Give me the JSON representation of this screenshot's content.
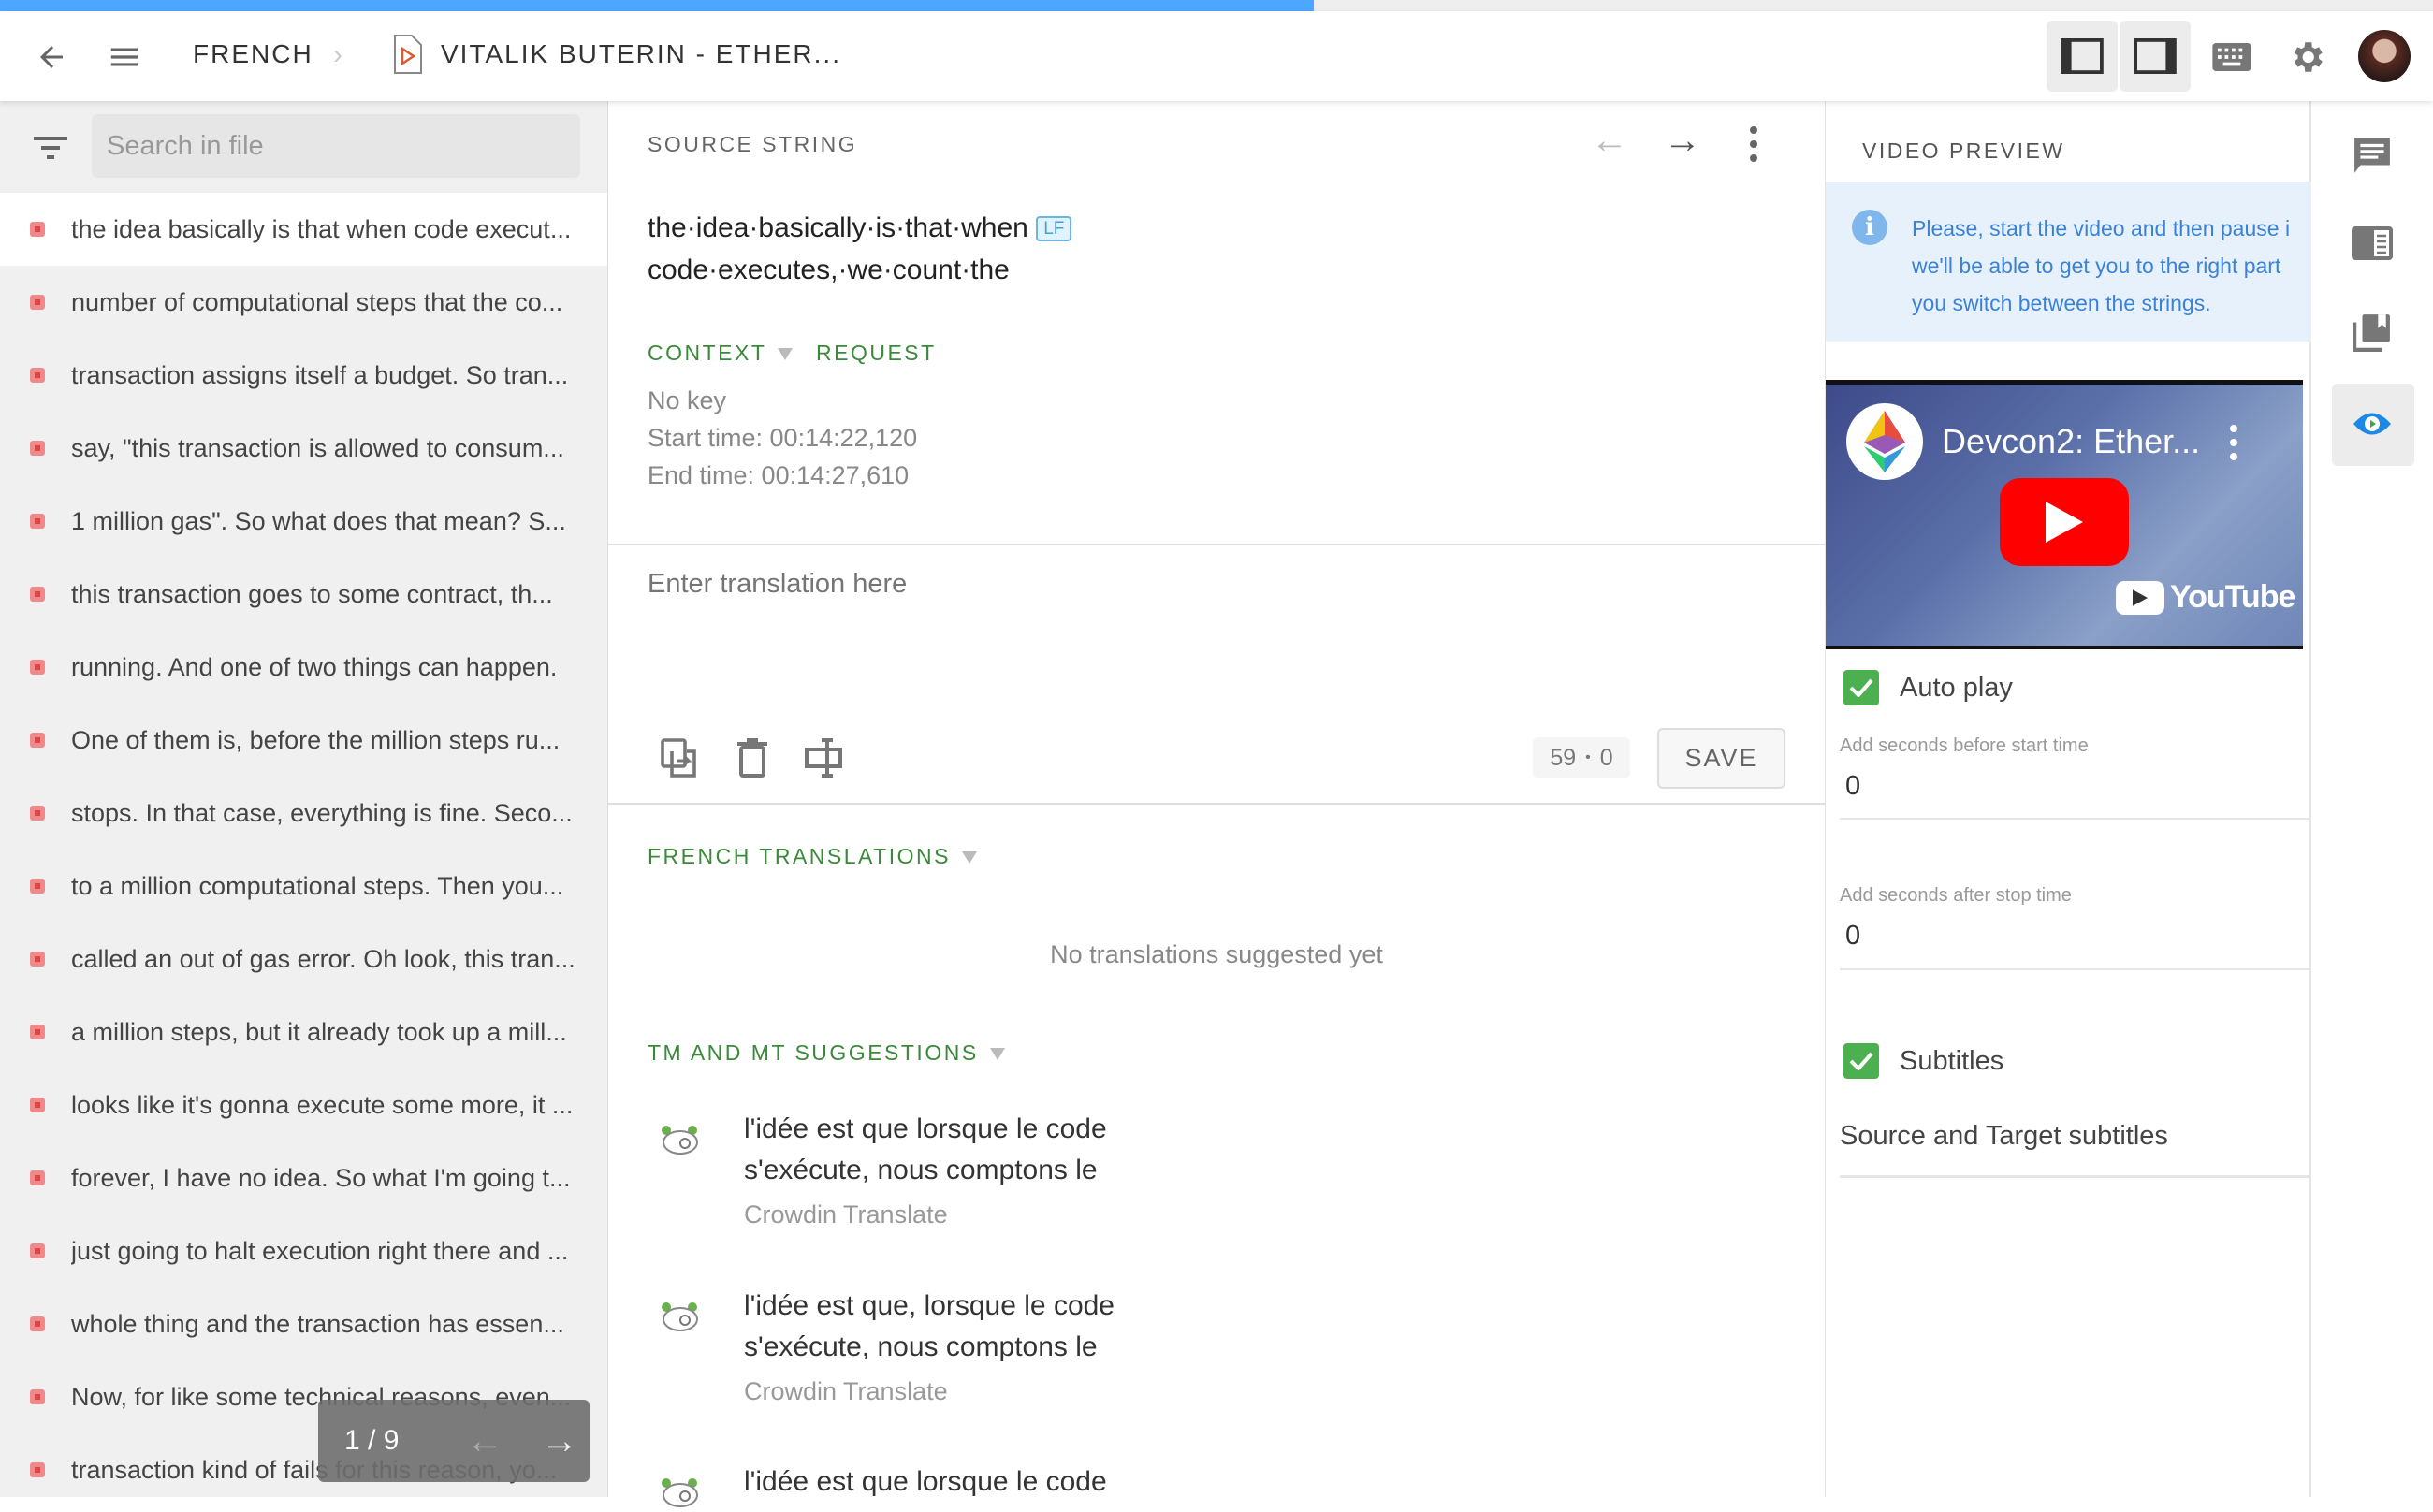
{
  "progress_percent": 54,
  "colors": {
    "accent": "#4da6ff",
    "green": "#3a8a3a",
    "error_dot": "#f08a8a",
    "info_bg": "#e6f1fc",
    "info_text": "#3b82d6"
  },
  "header": {
    "breadcrumb_language": "FRENCH",
    "file_title": "VITALIK BUTERIN - ETHER...",
    "icons": [
      "back-arrow-icon",
      "menu-icon",
      "chevron-right-icon",
      "video-file-icon",
      "layout-left-icon",
      "layout-right-icon",
      "keyboard-icon",
      "gear-icon",
      "avatar"
    ]
  },
  "left": {
    "search_placeholder": "Search in file",
    "items": [
      "the idea basically is that when code execut...",
      "number of computational steps that the co...",
      "transaction assigns itself a budget. So tran...",
      "say, \"this transaction is allowed to consum...",
      "1 million gas\". So what does that mean? S...",
      "this transaction goes to some contract, th...",
      "running. And one of two things can happen.",
      "One of them is, before the million steps ru...",
      "stops. In that case, everything is fine. Seco...",
      "to a million computational steps. Then you...",
      "called an out of gas error. Oh look, this tran...",
      "a million steps, but it already took up a mill...",
      "looks like it's gonna execute some more, it ...",
      "forever, I have no idea. So what I'm going t...",
      "just going to halt execution right there and ...",
      "whole thing and the transaction has essen...",
      "Now, for like some technical reasons, even...",
      "transaction kind of fails for this reason, yo..."
    ],
    "pager": {
      "text": "1 / 9"
    }
  },
  "editor": {
    "source_label": "SOURCE STRING",
    "source_lines": [
      "the·idea·basically·is·that·when",
      "code·executes,·we·count·the"
    ],
    "lf_badge": "LF",
    "context_tab": "CONTEXT",
    "request_tab": "REQUEST",
    "no_key": "No key",
    "start_time": "Start time: 00:14:22,120",
    "end_time": "End time: 00:14:27,610",
    "translation_placeholder": "Enter translation here",
    "counter_source": "59",
    "counter_target": "0",
    "save_label": "SAVE",
    "french_translations_label": "FRENCH TRANSLATIONS",
    "no_translations": "No translations suggested yet",
    "tm_mt_label": "TM AND MT SUGGESTIONS",
    "suggestions": [
      {
        "line1": "l'idée est que lorsque le code",
        "line2": "s'exécute, nous comptons le",
        "source": "Crowdin Translate"
      },
      {
        "line1": "l'idée est que, lorsque le code",
        "line2": "s'exécute, nous comptons le",
        "source": "Crowdin Translate"
      },
      {
        "line1": "l'idée est que lorsque le code"
      }
    ]
  },
  "video": {
    "label": "VIDEO PREVIEW",
    "info_lines": [
      "Please, start the video and then pause i",
      "we'll be able to get you to the right part ",
      "you switch between the strings."
    ],
    "video_title": "Devcon2: Ether...",
    "youtube_label": "YouTube",
    "autoplay_label": "Auto play",
    "autoplay_checked": true,
    "before_label": "Add seconds before start time",
    "before_value": "0",
    "after_label": "Add seconds after stop time",
    "after_value": "0",
    "subtitles_label": "Subtitles",
    "subtitles_checked": true,
    "subtitles_mode": "Source and Target subtitles"
  },
  "right_rail": {
    "icons": [
      "comments-icon",
      "terms-icon",
      "glossary-icon",
      "video-preview-icon"
    ],
    "active": "video-preview-icon"
  }
}
